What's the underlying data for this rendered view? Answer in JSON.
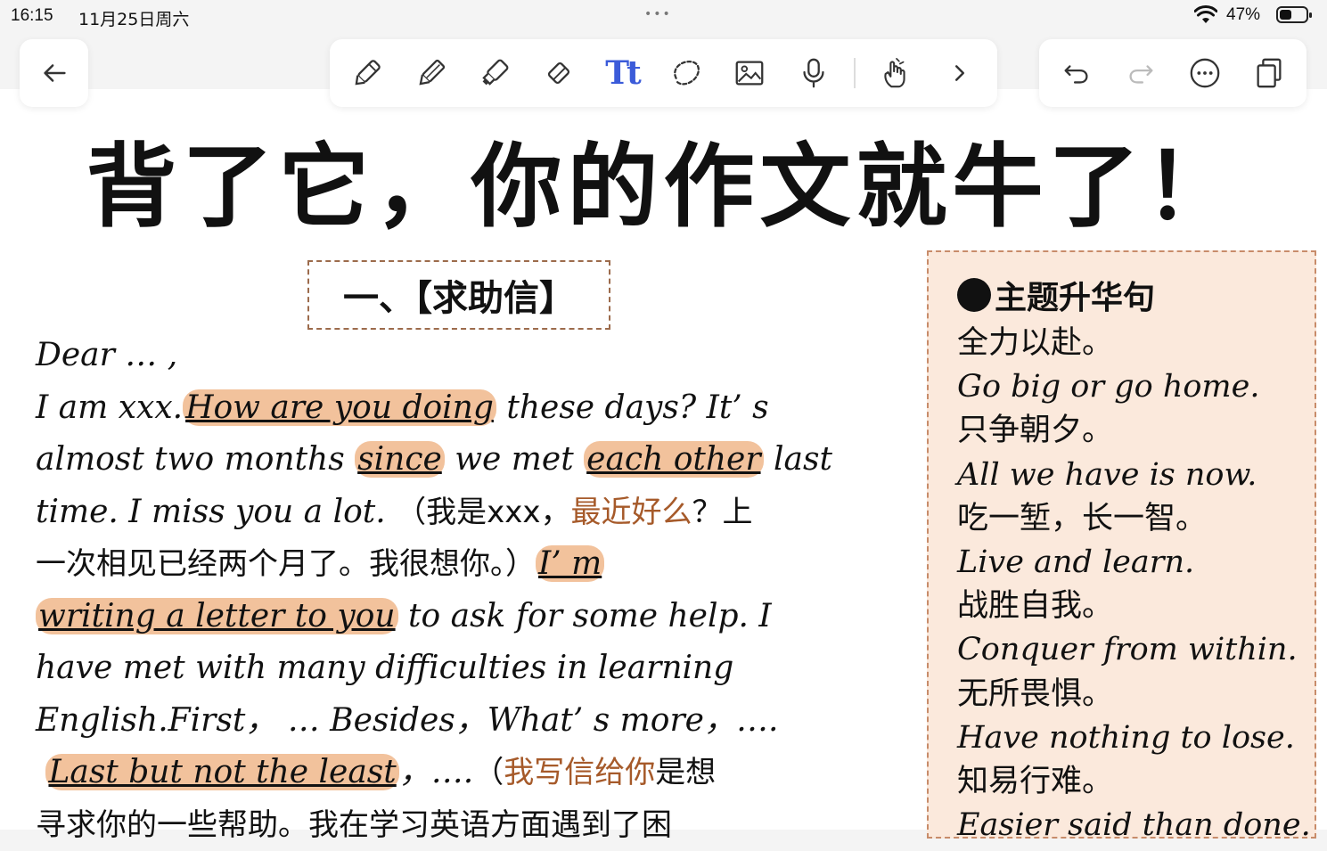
{
  "status_bar": {
    "time": "16:15",
    "date": "11月25日周六",
    "battery_percent": "47%",
    "battery_level": 0.47,
    "dots": "•••"
  },
  "toolbar": {
    "back_icon": "back-arrow-icon",
    "tools": [
      "pen-icon",
      "pencil-icon",
      "marker-icon",
      "eraser-icon",
      "text-tool-icon",
      "lasso-icon",
      "image-icon",
      "microphone-icon",
      "hand-pointer-icon",
      "chevron-right-icon"
    ],
    "text_tool_label": "Tt",
    "actions": [
      "undo-icon",
      "redo-icon",
      "more-icon",
      "pages-icon"
    ],
    "accent_color": "#3b5bd9"
  },
  "page": {
    "title": "背了它，你的作文就牛了！",
    "section_title": "一、【求助信】",
    "letter": {
      "greeting": "Dear … ,",
      "l1_a": " I am xxx.",
      "l1_hl": "How are you doing",
      "l1_b": " these days? It’ s",
      "l2_a": "almost two months ",
      "l2_hl1": "since",
      "l2_b": " we met ",
      "l2_hl2": "each other",
      "l2_c": " last",
      "l3_a": "time. I miss you a lot. ",
      "l3_cn_a": "（我是xxx，",
      "l3_cn_brown": "最近好么",
      "l3_cn_b": "？上",
      "l4_cn": "一次相见已经两个月了。我很想你。）",
      "l4_hl": "I’ m",
      "l5_hl": "writing a letter to you",
      "l5_b": " to ask for some help. I",
      "l6": "have met with many difficulties in learning",
      "l7": "English.First， … Besides，What’ s more，….",
      "l8_hl": "Last but not the least",
      "l8_b": "，….",
      "l8_cn_a": "（",
      "l8_cn_brown": "我写信给你",
      "l8_cn_b": "是想",
      "l9_cn": "寻求你的一些帮助。我在学习英语方面遇到了困"
    },
    "highlight_color": "#f2c29c",
    "brown_color": "#a65a2a"
  },
  "side_panel": {
    "title": "主题升华句",
    "items": [
      {
        "text": "全力以赴。",
        "lang": "zh"
      },
      {
        "text": "Go big or go home.",
        "lang": "en"
      },
      {
        "text": "只争朝夕。",
        "lang": "zh"
      },
      {
        "text": "All we have is now.",
        "lang": "en"
      },
      {
        "text": "吃一堑，长一智。",
        "lang": "zh"
      },
      {
        "text": "Live and learn.",
        "lang": "en"
      },
      {
        "text": "战胜自我。",
        "lang": "zh"
      },
      {
        "text": "Conquer from within.",
        "lang": "en"
      },
      {
        "text": "无所畏惧。",
        "lang": "zh"
      },
      {
        "text": "Have nothing to lose.",
        "lang": "en"
      },
      {
        "text": "知易行难。",
        "lang": "zh"
      },
      {
        "text": "Easier said than done.",
        "lang": "en"
      }
    ],
    "background": "#fbe9dc",
    "border_color": "#c88c6a"
  }
}
